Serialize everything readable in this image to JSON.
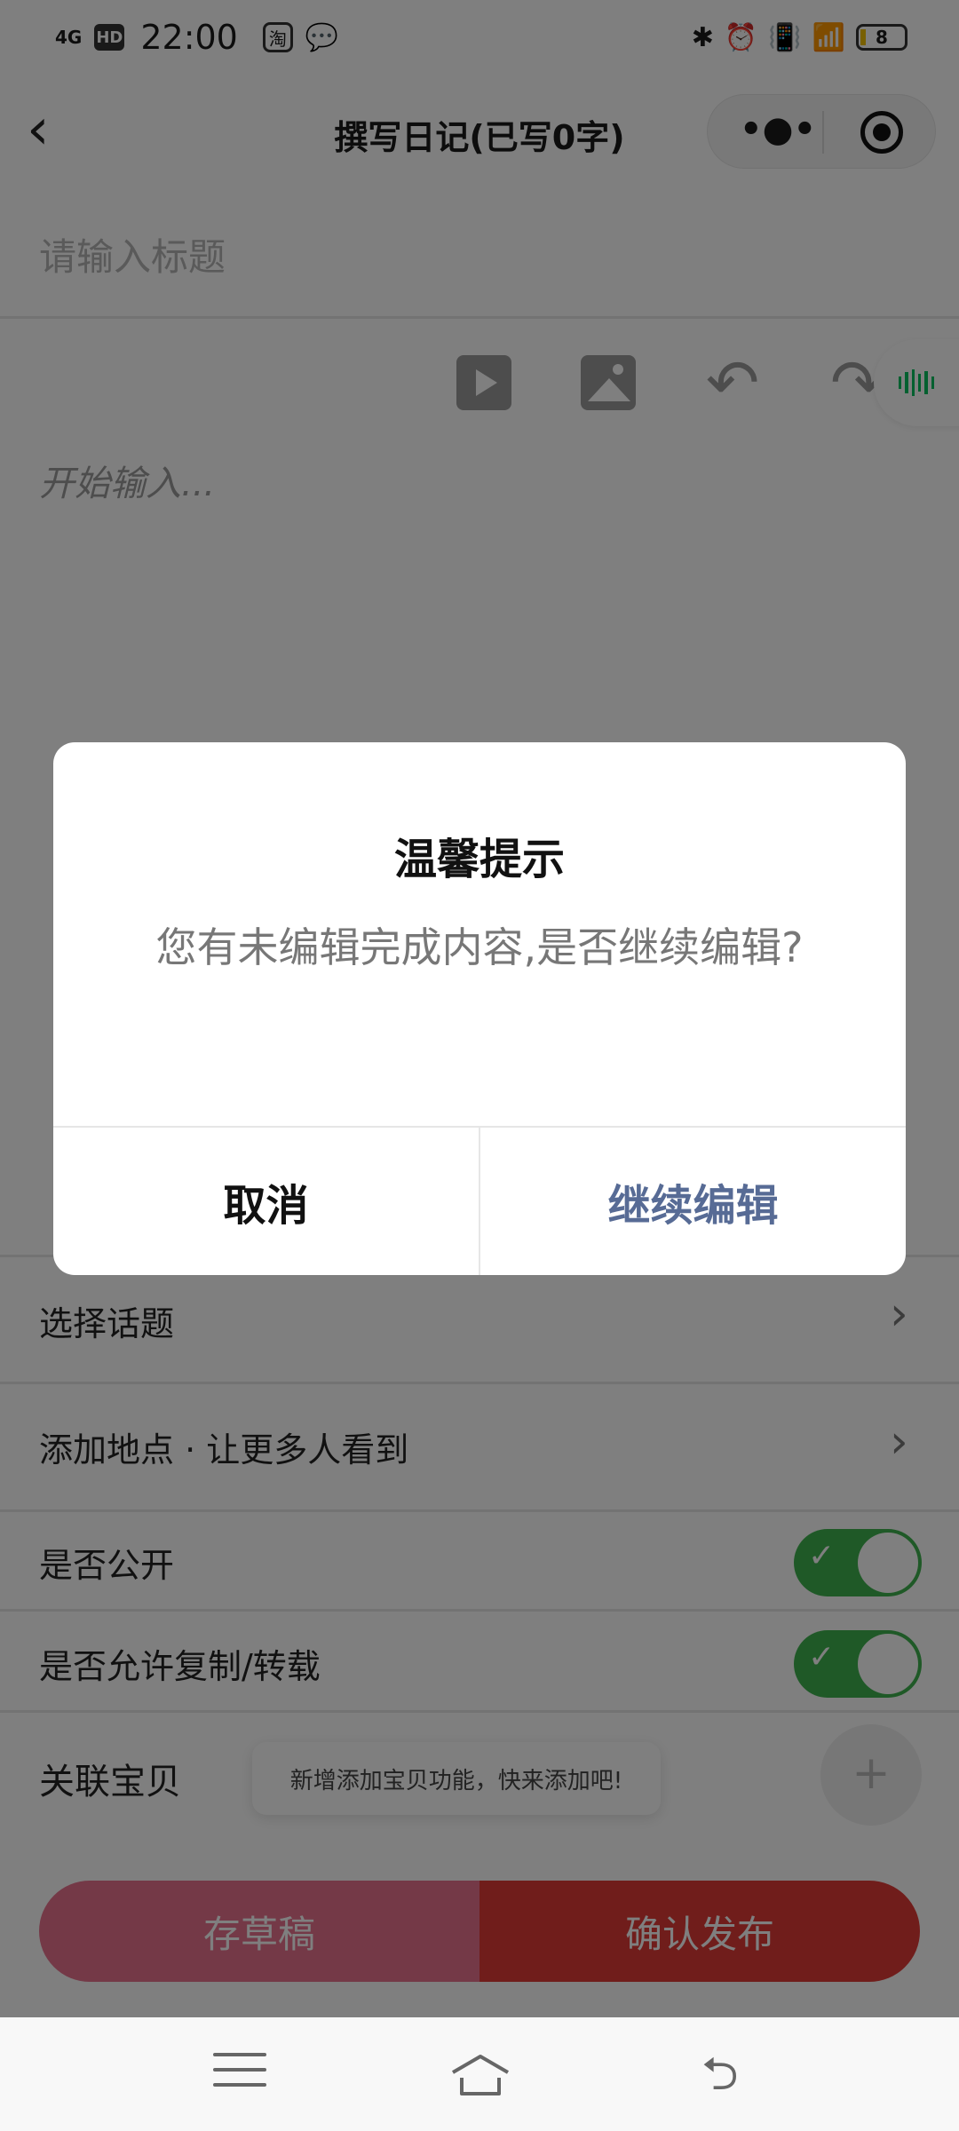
{
  "status_bar": {
    "network": "4G",
    "hd": "HD",
    "time": "22:00",
    "app_icon_1": "淘",
    "battery": "8"
  },
  "nav": {
    "title": "撰写日记(已写0字)",
    "more_label": "•●•"
  },
  "editor": {
    "title_placeholder": "请输入标题",
    "content_placeholder": "开始输入..."
  },
  "settings": {
    "topic": "选择话题",
    "location": "添加地点 · 让更多人看到",
    "public": "是否公开",
    "allow_copy": "是否允许复制/转载",
    "related_item": "关联宝贝",
    "tooltip": "新增添加宝贝功能，快来添加吧!",
    "public_on": true,
    "allow_copy_on": true
  },
  "actions": {
    "draft": "存草稿",
    "publish": "确认发布"
  },
  "dialog": {
    "title": "温馨提示",
    "message": "您有未编辑完成内容,是否继续编辑?",
    "cancel": "取消",
    "confirm": "继续编辑"
  },
  "colors": {
    "accent_green": "#3fb34f",
    "publish_red": "#e03a37",
    "draft_pink": "#e8738e",
    "dialog_link": "#576b95"
  }
}
